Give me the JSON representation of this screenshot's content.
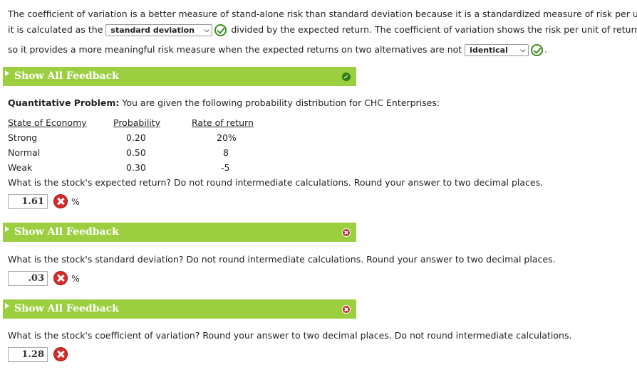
{
  "intro": {
    "line1": "The coefficient of variation is a better measure of stand-alone risk than standard deviation because it is a standardized measure of risk per unit;",
    "line2_pre": "it is calculated as the",
    "select1_value": "standard deviation",
    "line2_post": "divided by the expected return. The coefficient of variation shows the risk per unit of return,",
    "line3_pre": "so it provides a more meaningful risk measure when the expected returns on two alternatives are not",
    "select2_value": "identical",
    "line3_post": "."
  },
  "feedback_label": "Show All Feedback",
  "problem": {
    "heading": "Quantitative Problem:",
    "text": " You are given the following probability distribution for CHC Enterprises:"
  },
  "table": {
    "headers": [
      "State of Economy",
      "Probability",
      "Rate of return"
    ],
    "rows": [
      {
        "state": "Strong",
        "prob": "0.20",
        "rate": "20%"
      },
      {
        "state": "Normal",
        "prob": "0.50",
        "rate": "8"
      },
      {
        "state": "Weak",
        "prob": "0.30",
        "rate": "-5"
      }
    ]
  },
  "questions": [
    {
      "text": "What is the stock's expected return? Do not round intermediate calculations. Round your answer to two decimal places.",
      "answer": "1.61",
      "unit": "%"
    },
    {
      "text": "What is the stock's standard deviation? Do not round intermediate calculations. Round your answer to two decimal places.",
      "answer": ".03",
      "unit": "%"
    },
    {
      "text": "What is the stock's coefficient of variation? Round your answer to two decimal places. Do not round intermediate calculations.",
      "answer": "1.28",
      "unit": ""
    }
  ],
  "colors": {
    "feedback_bar": "#9ccf3f",
    "correct": "#3a8f19",
    "incorrect": "#d32b2b"
  }
}
